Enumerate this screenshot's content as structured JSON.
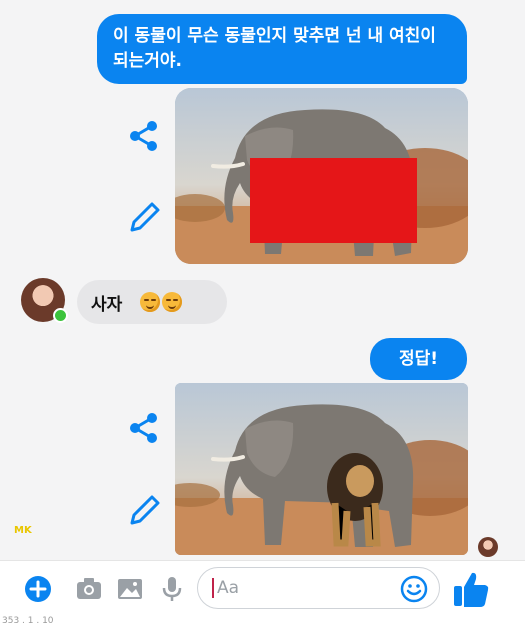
{
  "messages": {
    "question": "이 동물이 무슨 동물인지 맞추면 넌 내 여친이 되는거야.",
    "answer_guess": "사자",
    "reply": "정답!"
  },
  "watermark": "MK",
  "composer": {
    "placeholder": "Aa"
  },
  "bottom_text": "353 . 1 . 10",
  "colors": {
    "accent": "#0a84f0",
    "bubble_in": "#e6e6e8",
    "censor": "#e51618"
  },
  "icons": [
    "share-icon",
    "edit-icon",
    "plus-icon",
    "camera-icon",
    "gallery-icon",
    "microphone-icon",
    "emoji-icon",
    "thumbs-up-icon"
  ]
}
